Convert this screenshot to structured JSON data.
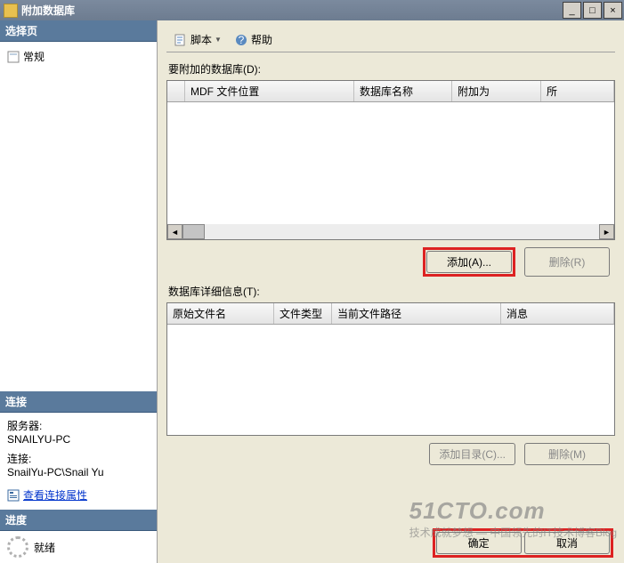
{
  "window": {
    "title": "附加数据库",
    "min_tooltip": "最小化",
    "max_tooltip": "最大化",
    "close_tooltip": "关闭"
  },
  "sidebar": {
    "select_page_header": "选择页",
    "general_item": "常规",
    "connection_header": "连接",
    "server_label": "服务器:",
    "server_value": "SNAILYU-PC",
    "conn_label": "连接:",
    "conn_value": "SnailYu-PC\\Snail Yu",
    "view_props_link": "查看连接属性",
    "progress_header": "进度",
    "progress_status": "就绪"
  },
  "toolbar": {
    "script_label": "脚本",
    "help_label": "帮助"
  },
  "content": {
    "attach_label": "要附加的数据库(D):",
    "columns": {
      "small_arrow": "▶",
      "mdf_location": "MDF 文件位置",
      "db_name": "数据库名称",
      "attach_as": "附加为",
      "owner_prefix": "所"
    },
    "add_btn": "添加(A)...",
    "remove_btn": "删除(R)",
    "details_label": "数据库详细信息(T):",
    "detail_columns": {
      "orig_filename": "原始文件名",
      "file_type": "文件类型",
      "current_path": "当前文件路径",
      "message": "消息"
    },
    "add_dir_btn": "添加目录(C)...",
    "remove_m_btn": "删除(M)"
  },
  "footer": {
    "ok": "确定",
    "cancel": "取消"
  },
  "watermark": {
    "line1": "51CTO.com",
    "line2": "技术成就梦想 — 中国领先的IT技术博客Blog"
  }
}
